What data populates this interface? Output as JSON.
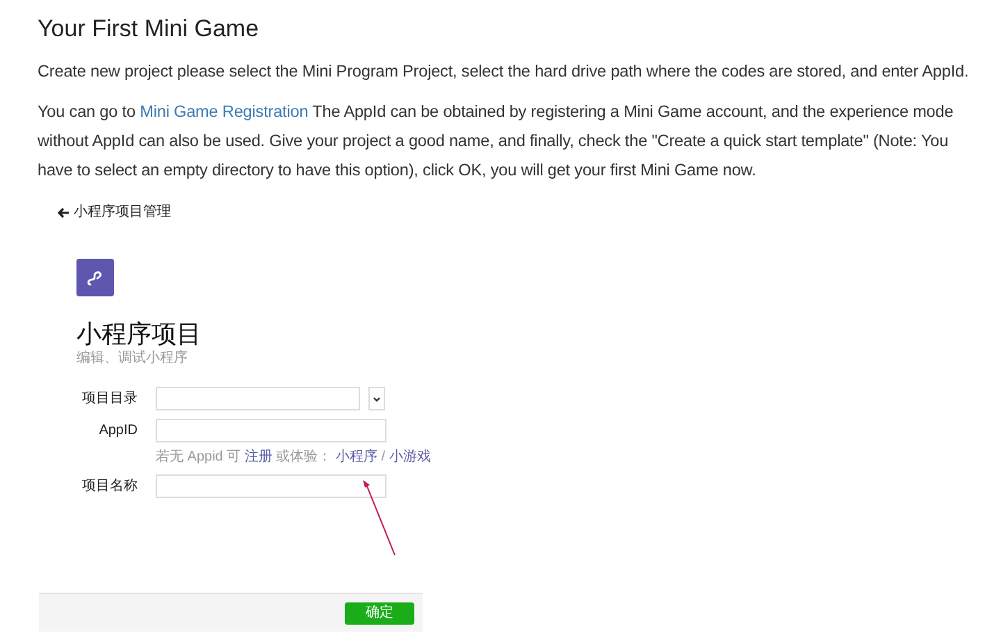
{
  "heading": "Your First Mini Game",
  "paragraphs": [
    [
      {
        "text": "Create new project please select the Mini Program Project, select the hard drive path where the codes are stored, and enter AppId.",
        "link": false
      }
    ],
    [
      {
        "text": "You can go to",
        "link": false
      },
      {
        "text": "Mini Game Registration",
        "link": true
      },
      {
        "text": "The AppId can be obtained by registering a Mini Game account, and the experience mode without AppId can also be used. Give your project a good name, and finally, check the \"Create a quick start template\" (Note: You have to select an empty directory to have this option), click OK, you will get your first Mini Game now.",
        "link": false
      }
    ]
  ],
  "screenshot": {
    "back_link": "小程序项目管理",
    "title": "小程序项目",
    "subtitle": "编辑、调试小程序",
    "fields": [
      {
        "label": "项目目录",
        "kind": "dropdown"
      },
      {
        "label": "AppID",
        "kind": "text",
        "hint": [
          {
            "text": "若无 Appid 可",
            "link": false
          },
          {
            "text": "注册",
            "link": true
          },
          {
            "text": "或体验：",
            "link": false
          },
          {
            "text": "小程序",
            "link": true
          },
          {
            "text": "/",
            "link": false
          },
          {
            "text": "小游戏",
            "link": true
          }
        ]
      },
      {
        "label": "项目名称",
        "kind": "text"
      }
    ],
    "confirm_button": "确定"
  }
}
